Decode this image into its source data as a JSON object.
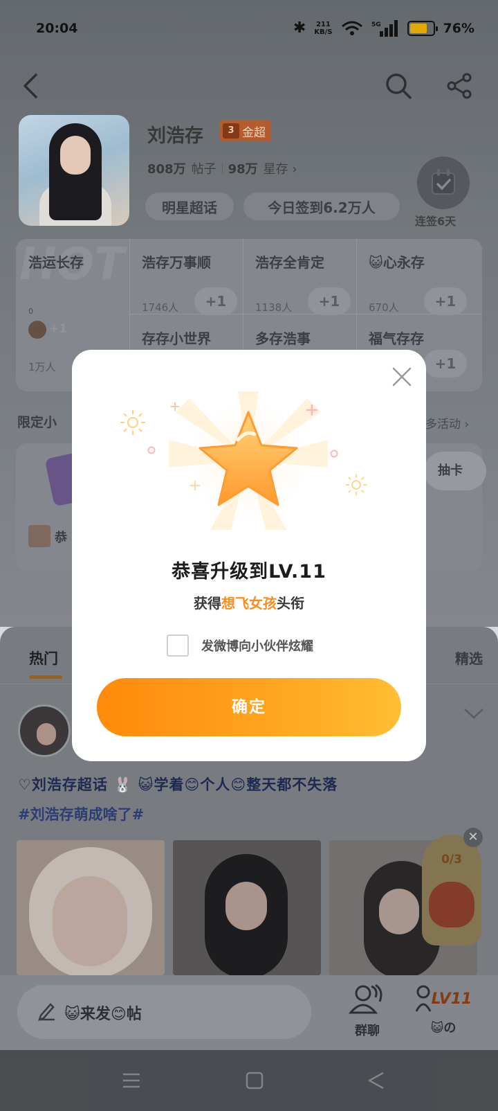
{
  "status_bar": {
    "time": "20:04",
    "net_speed_value": "211",
    "net_speed_unit": "KB/S",
    "network": "5G",
    "battery_percent": "76%",
    "battery_level": 0.76
  },
  "header": {
    "title": "刘浩存",
    "badge_level": "3",
    "badge_label": "金超",
    "posts_count": "808万",
    "posts_label": "帖子",
    "fans_count": "98万",
    "fans_label": "星存 ›",
    "pill_star": "明星超话",
    "pill_checkin": "今日签到6.2万人 ",
    "checkin_streak": "连签6天"
  },
  "hot_grid": {
    "watermark": "HOT",
    "first": {
      "name": "浩运长存",
      "count": "1万人",
      "plus": "+1",
      "small": "0"
    },
    "cells": [
      {
        "name": "浩存万事顺",
        "count": "1746人",
        "plus": "+1"
      },
      {
        "name": "浩存全肯定",
        "count": "1138人",
        "plus": "+1"
      },
      {
        "name": "😺心永存",
        "count": "670人",
        "plus": "+1"
      },
      {
        "name": "存存小世界",
        "count": "",
        "plus": ""
      },
      {
        "name": "多存浩事",
        "count": "",
        "plus": ""
      },
      {
        "name": "福气存存",
        "count": "",
        "plus": "+1"
      }
    ]
  },
  "limited": {
    "title": "限定小",
    "more": "多活动 ›",
    "button": "抽卡",
    "user": "恭"
  },
  "feed": {
    "tab_hot": "热门",
    "tab_pick": "精选",
    "post_text": "♡刘浩存超话 🐰 😺学着😊个人😊整天都不失落",
    "post_tag": "#刘浩存萌成啥了#",
    "close": "✕",
    "lucky_count": "0/3"
  },
  "bottom_bar": {
    "compose": "😺来发😊帖",
    "group_chat": "群聊",
    "level_icon": "LV11",
    "level_label": "😺の"
  },
  "dialog": {
    "title": "恭喜升级到LV.11",
    "sub_prefix": "获得",
    "sub_highlight": "想飞女孩",
    "sub_suffix": "头衔",
    "share_label": "发微博向小伙伴炫耀",
    "confirm": "确定"
  },
  "colors": {
    "accent": "#ff8c1a",
    "confirm_start": "#ff8a0a",
    "confirm_end": "#ffbe35",
    "star": "#ffa53a"
  },
  "icons": [
    "bluetooth-icon",
    "wifi-icon",
    "signal-icon",
    "battery-icon",
    "back-icon",
    "search-icon",
    "share-icon",
    "calendar-check-icon",
    "close-icon",
    "star-icon",
    "pencil-icon",
    "group-chat-icon",
    "menu-icon",
    "home-icon",
    "back-triangle-icon"
  ]
}
